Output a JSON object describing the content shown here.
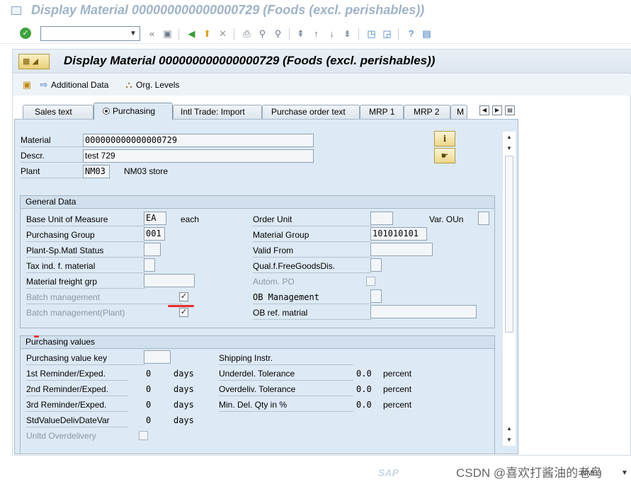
{
  "window": {
    "title": "Display Material 000000000000000729 (Foods (excl. perishables))"
  },
  "toolbar": {
    "command_value": ""
  },
  "header": {
    "title": "Display Material 000000000000000729 (Foods (excl. perishables))"
  },
  "app_toolbar": {
    "additional_data": "Additional Data",
    "org_levels": "Org. Levels"
  },
  "tabs": [
    "Sales text",
    "Purchasing",
    "Intl Trade: Import",
    "Purchase order text",
    "MRP 1",
    "MRP 2",
    "M"
  ],
  "active_tab": "Purchasing",
  "material": {
    "material_label": "Material",
    "material_value": "000000000000000729",
    "descr_label": "Descr.",
    "descr_value": "test 729",
    "plant_label": "Plant",
    "plant_value": "NM03",
    "plant_name": "NM03 store"
  },
  "general": {
    "title": "General Data",
    "base_uom_label": "Base Unit of Measure",
    "base_uom_value": "EA",
    "base_uom_text": "each",
    "order_unit_label": "Order Unit",
    "order_unit_value": "",
    "var_oun_label": "Var. OUn",
    "purch_group_label": "Purchasing Group",
    "purch_group_value": "001",
    "material_group_label": "Material Group",
    "material_group_value": "101010101",
    "plant_status_label": "Plant-Sp.Matl Status",
    "valid_from_label": "Valid From",
    "tax_label": "Tax ind. f. material",
    "qual_label": "Qual.f.FreeGoodsDis.",
    "freight_label": "Material freight grp",
    "autom_po_label": "Autom. PO",
    "batch_label": "Batch management",
    "batch_checked": true,
    "ob_mgmt_label": "OB Management",
    "batch_plant_label": "Batch management(Plant)",
    "batch_plant_checked": true,
    "ob_ref_label": "OB ref. matrial"
  },
  "purchasing_values": {
    "title": "Purchasing values",
    "value_key_label": "Purchasing value key",
    "shipping_label": "Shipping Instr.",
    "rem1_label": "1st Reminder/Exped.",
    "rem1_value": "0",
    "rem1_unit": "days",
    "underdel_label": "Underdel. Tolerance",
    "underdel_value": "0.0",
    "underdel_unit": "percent",
    "rem2_label": "2nd Reminder/Exped.",
    "rem2_value": "0",
    "rem2_unit": "days",
    "overdel_label": "Overdeliv. Tolerance",
    "overdel_value": "0.0",
    "overdel_unit": "percent",
    "rem3_label": "3rd Reminder/Exped.",
    "rem3_value": "0",
    "rem3_unit": "days",
    "mindel_label": "Min. Del. Qty in %",
    "mindel_value": "0.0",
    "mindel_unit": "percent",
    "stdvalue_label": "StdValueDelivDateVar",
    "stdvalue_value": "0",
    "stdvalue_unit": "days",
    "unltd_label": "Unltd Overdelivery"
  },
  "status": {
    "system": "NM03",
    "sap_logo": "SAP"
  },
  "watermark": "CSDN @喜欢打酱油的老鸟",
  "colors": {
    "accent": "#dde9f4",
    "annotation": "#e62e2e"
  }
}
